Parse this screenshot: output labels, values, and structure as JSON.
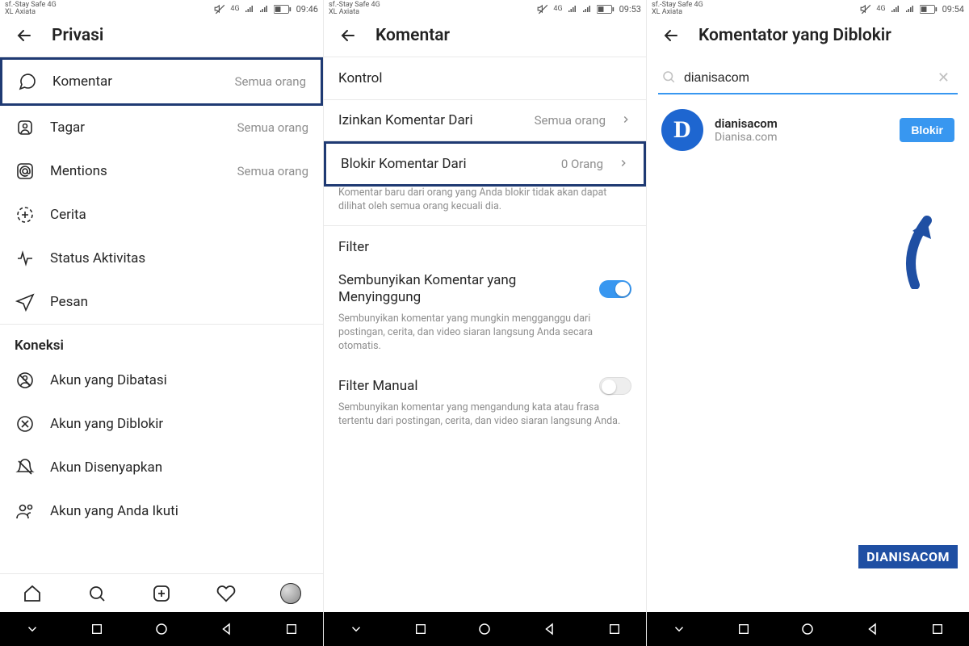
{
  "status": {
    "line1": "sf.-Stay Safe 4G",
    "line2": "XL Axiata",
    "t1": "09:46",
    "t2": "09:53",
    "t3": "09:54"
  },
  "screen1": {
    "title": "Privasi",
    "items": {
      "komentar": {
        "label": "Komentar",
        "value": "Semua orang"
      },
      "tagar": {
        "label": "Tagar",
        "value": "Semua orang"
      },
      "mentions": {
        "label": "Mentions",
        "value": "Semua orang"
      },
      "cerita": {
        "label": "Cerita"
      },
      "status": {
        "label": "Status Aktivitas"
      },
      "pesan": {
        "label": "Pesan"
      }
    },
    "section": "Koneksi",
    "conn": {
      "dibatasi": "Akun yang Dibatasi",
      "diblokir": "Akun yang Diblokir",
      "disenyap": "Akun Disenyapkan",
      "ikuti": "Akun yang Anda Ikuti"
    }
  },
  "screen2": {
    "title": "Komentar",
    "section1": "Kontrol",
    "izinkan": {
      "label": "Izinkan Komentar Dari",
      "value": "Semua orang"
    },
    "blokir": {
      "label": "Blokir Komentar Dari",
      "value": "0 Orang"
    },
    "blokir_desc": "Komentar baru dari orang yang Anda blokir tidak akan dapat dilihat oleh semua orang kecuali dia.",
    "section2": "Filter",
    "hide": {
      "label": "Sembunyikan Komentar yang Menyinggung"
    },
    "hide_desc": "Sembunyikan komentar yang mungkin mengganggu dari postingan, cerita, dan video siaran langsung Anda secara otomatis.",
    "manual": {
      "label": "Filter Manual"
    },
    "manual_desc": "Sembunyikan komentar yang mengandung kata atau frasa tertentu dari postingan, cerita, dan video siaran langsung Anda."
  },
  "screen3": {
    "title": "Komentator yang Diblokir",
    "search_value": "dianisacom",
    "avatar_letter": "D",
    "result": {
      "username": "dianisacom",
      "fullname": "Dianisa.com"
    },
    "block_label": "Blokir"
  },
  "watermark": "DIANISACOM"
}
